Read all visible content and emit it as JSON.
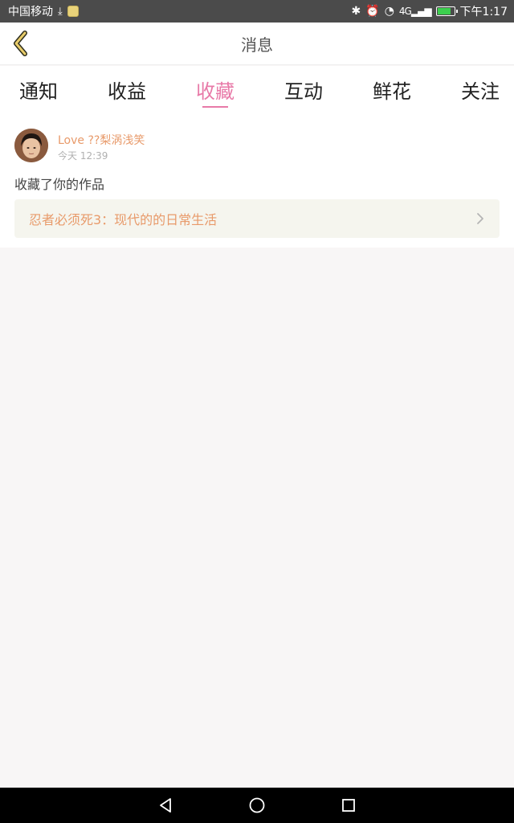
{
  "status_bar": {
    "carrier": "中国移动",
    "download_icon": "download-icon",
    "network": "4G",
    "time": "下午1:17",
    "battery_level": 0.85
  },
  "header": {
    "title": "消息",
    "back_icon": "chevron-left-icon"
  },
  "tabs": [
    {
      "label": "通知",
      "active": false
    },
    {
      "label": "收益",
      "active": false
    },
    {
      "label": "收藏",
      "active": true
    },
    {
      "label": "互动",
      "active": false
    },
    {
      "label": "鲜花",
      "active": false
    },
    {
      "label": "关注",
      "active": false
    }
  ],
  "notification": {
    "user_name": "Love ??梨涡浅笑",
    "timestamp": "今天 12:39",
    "action": "收藏了你的作品",
    "work_title": "忍者必须死3：现代的的日常生活"
  },
  "colors": {
    "accent": "#e87aa8",
    "name_color": "#e89a6a",
    "link_bg": "#f5f5ee"
  },
  "nav": {
    "back": "triangle-back-icon",
    "home": "circle-home-icon",
    "recents": "square-recents-icon"
  }
}
